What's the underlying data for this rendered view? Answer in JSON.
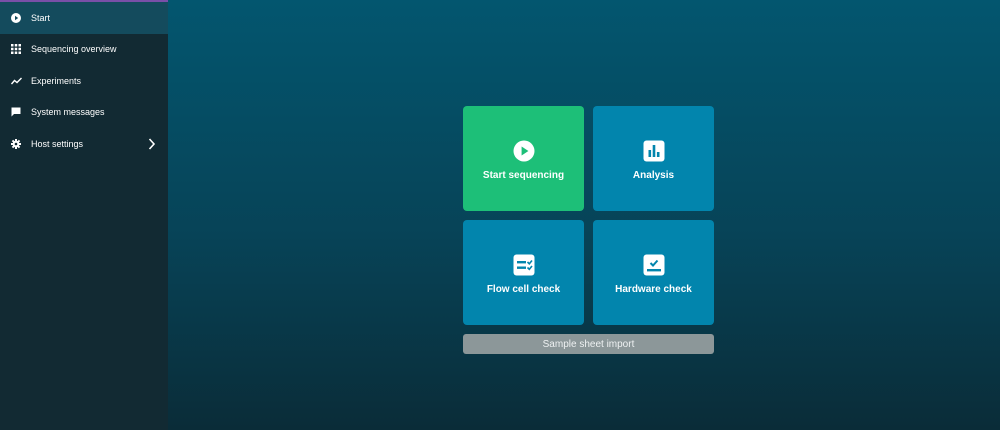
{
  "sidebar": {
    "items": [
      {
        "label": "Start",
        "icon": "play-circle-icon",
        "active": true
      },
      {
        "label": "Sequencing overview",
        "icon": "grid-icon"
      },
      {
        "label": "Experiments",
        "icon": "trend-line-icon"
      },
      {
        "label": "System messages",
        "icon": "message-icon"
      },
      {
        "label": "Host settings",
        "icon": "gear-icon",
        "has_submenu": true
      }
    ]
  },
  "tiles": [
    {
      "label": "Start sequencing",
      "icon": "play-circle-icon",
      "color": "#1dbf78"
    },
    {
      "label": "Analysis",
      "icon": "bar-chart-icon",
      "color": "#0285ad"
    },
    {
      "label": "Flow cell check",
      "icon": "flow-cell-check-icon",
      "color": "#0285ad"
    },
    {
      "label": "Hardware check",
      "icon": "hardware-check-icon",
      "color": "#0285ad"
    }
  ],
  "import_button": {
    "label": "Sample sheet import"
  },
  "colors": {
    "sidebar_bg": "#122a33",
    "sidebar_active": "#144b5d",
    "accent_green": "#1dbf78",
    "tile_blue": "#0285ad",
    "disabled_gray": "#8c9799"
  }
}
